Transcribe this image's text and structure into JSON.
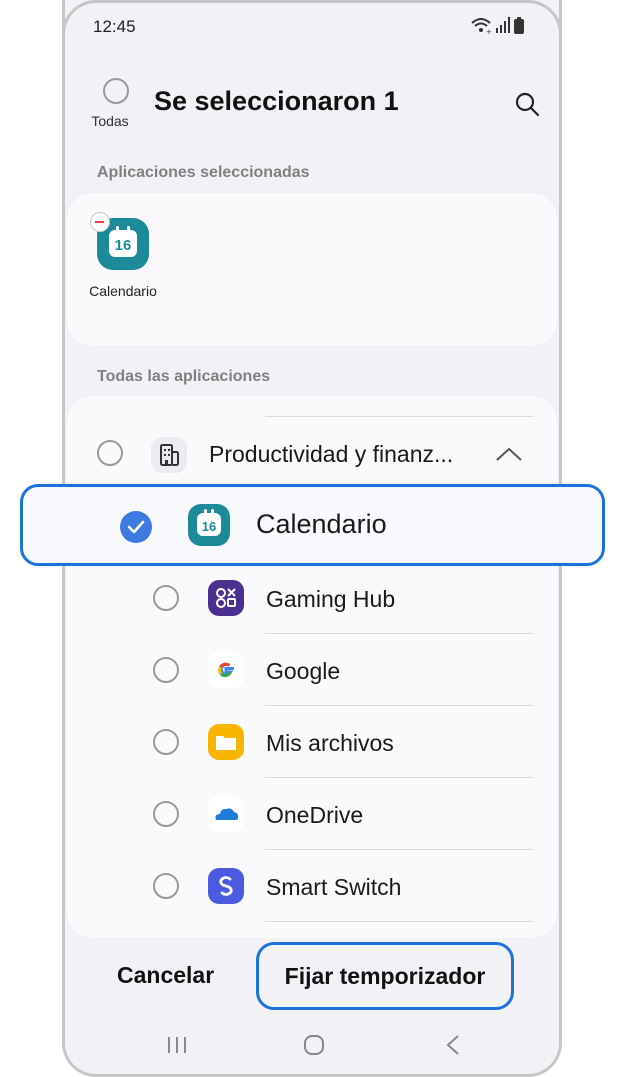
{
  "status_bar": {
    "time": "12:45"
  },
  "header": {
    "all_label": "Todas",
    "title": "Se seleccionaron 1"
  },
  "selected_section": {
    "label": "Aplicaciones seleccionadas",
    "apps": [
      {
        "name": "Calendario",
        "icon": "calendar-icon",
        "icon_number": "16"
      }
    ]
  },
  "all_section": {
    "label": "Todas las aplicaciones",
    "group": {
      "name": "Productividad y finanz...",
      "icon": "building-icon",
      "expanded": true
    },
    "apps": [
      {
        "name": "Calendario",
        "icon": "calendar-icon",
        "icon_number": "16",
        "checked": true
      },
      {
        "name": "Gaming Hub",
        "icon": "gaming-hub-icon",
        "checked": false
      },
      {
        "name": "Google",
        "icon": "google-icon",
        "checked": false
      },
      {
        "name": "Mis archivos",
        "icon": "folder-icon",
        "checked": false
      },
      {
        "name": "OneDrive",
        "icon": "onedrive-icon",
        "checked": false
      },
      {
        "name": "Smart Switch",
        "icon": "smart-switch-icon",
        "checked": false
      }
    ]
  },
  "footer": {
    "cancel_label": "Cancelar",
    "confirm_label": "Fijar temporizador"
  },
  "colors": {
    "accent": "#1a73d9",
    "check": "#3e7ae0",
    "calendar": "#1c8a99",
    "background": "#f1f1f6"
  }
}
